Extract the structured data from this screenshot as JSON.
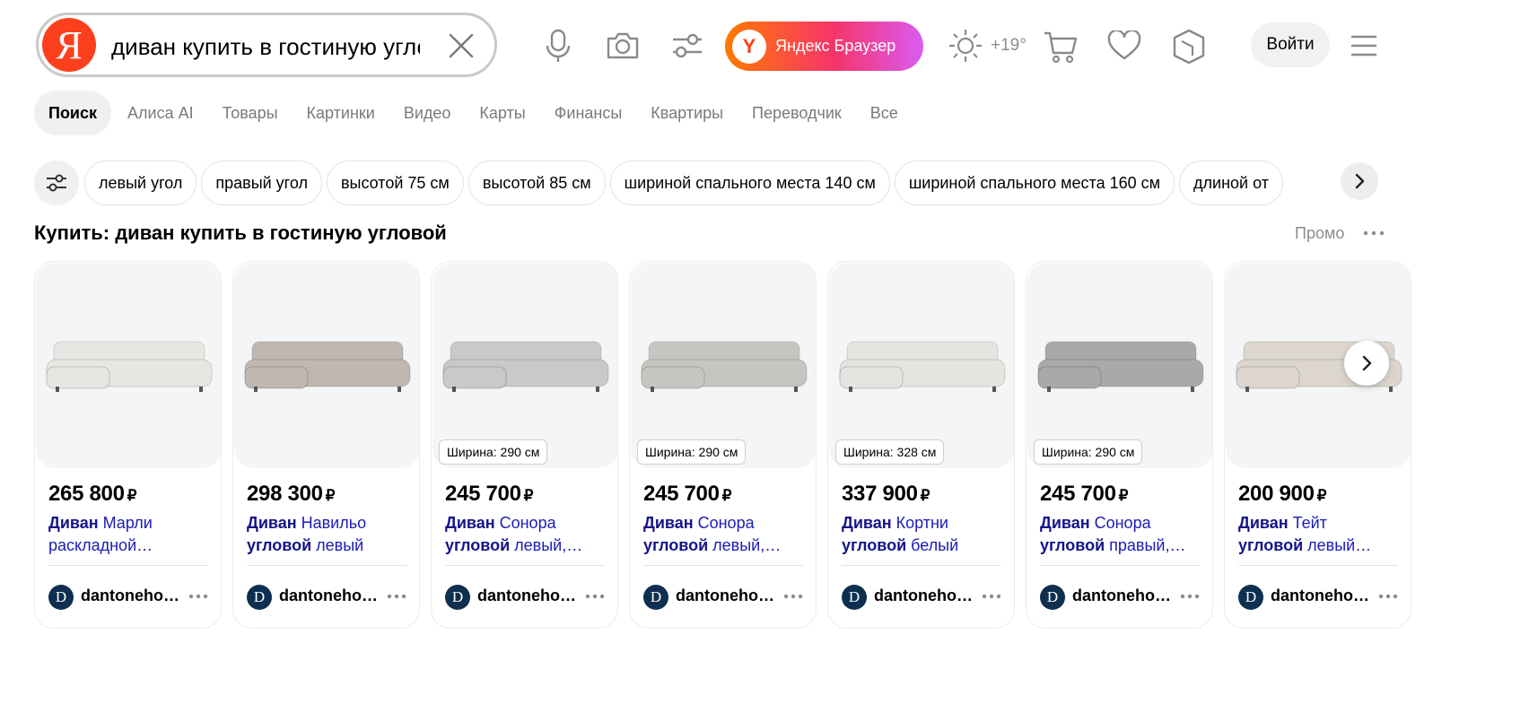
{
  "search": {
    "logo_letter": "Я",
    "query": "диван купить в гостиную углов"
  },
  "header": {
    "browser_button": "Яндекс Браузер",
    "weather": "+19°",
    "login": "Войти",
    "icons": [
      "microphone-icon",
      "camera-icon",
      "filters-icon",
      "weather-sun-icon",
      "cart-icon",
      "heart-icon",
      "cube-icon",
      "hamburger-menu-icon"
    ]
  },
  "tabs": [
    "Поиск",
    "Алиса AI",
    "Товары",
    "Картинки",
    "Видео",
    "Карты",
    "Финансы",
    "Квартиры",
    "Переводчик",
    "Все"
  ],
  "chips": [
    "левый угол",
    "правый угол",
    "высотой 75 см",
    "высотой 85 см",
    "шириной спального места 140 см",
    "шириной спального места 160 см",
    "длиной от"
  ],
  "section": {
    "title": "Купить: диван купить в гостиную угловой",
    "promo": "Промо"
  },
  "products": [
    {
      "price": "265 800",
      "currency": "₽",
      "title_bold": "Диван",
      "title_rest": " Марли раскладной…",
      "badge": "",
      "shop_initial": "D",
      "shop": "dantoneho…",
      "sofa_color": "#e8e6e3"
    },
    {
      "price": "298 300",
      "currency": "₽",
      "title_bold": "Диван",
      "title_rest": " Навильо",
      "title_bold2": "угловой",
      "title_rest2": " левый",
      "badge": "",
      "shop_initial": "D",
      "shop": "dantoneho…",
      "sofa_color": "#bfb7b1"
    },
    {
      "price": "245 700",
      "currency": "₽",
      "title_bold": "Диван",
      "title_rest": " Сонора",
      "title_bold2": "угловой",
      "title_rest2": " левый,…",
      "badge": "Ширина: 290 см",
      "shop_initial": "D",
      "shop": "dantoneho…",
      "sofa_color": "#c9c9c9"
    },
    {
      "price": "245 700",
      "currency": "₽",
      "title_bold": "Диван",
      "title_rest": " Сонора",
      "title_bold2": "угловой",
      "title_rest2": " левый,…",
      "badge": "Ширина: 290 см",
      "shop_initial": "D",
      "shop": "dantoneho…",
      "sofa_color": "#c7c5c2"
    },
    {
      "price": "337 900",
      "currency": "₽",
      "title_bold": "Диван",
      "title_rest": " Кортни",
      "title_bold2": "угловой",
      "title_rest2": " белый",
      "badge": "Ширина: 328 см",
      "shop_initial": "D",
      "shop": "dantoneho…",
      "sofa_color": "#e6e4e0"
    },
    {
      "price": "245 700",
      "currency": "₽",
      "title_bold": "Диван",
      "title_rest": " Сонора",
      "title_bold2": "угловой",
      "title_rest2": " правый,…",
      "badge": "Ширина: 290 см",
      "shop_initial": "D",
      "shop": "dantoneho…",
      "sofa_color": "#aaa9a8"
    },
    {
      "price": "200 900",
      "currency": "₽",
      "title_bold": "Диван",
      "title_rest": " Тейт",
      "title_bold2": "угловой",
      "title_rest2": " левый…",
      "badge": "",
      "shop_initial": "D",
      "shop": "dantoneho…",
      "sofa_color": "#dcd6cf"
    }
  ]
}
